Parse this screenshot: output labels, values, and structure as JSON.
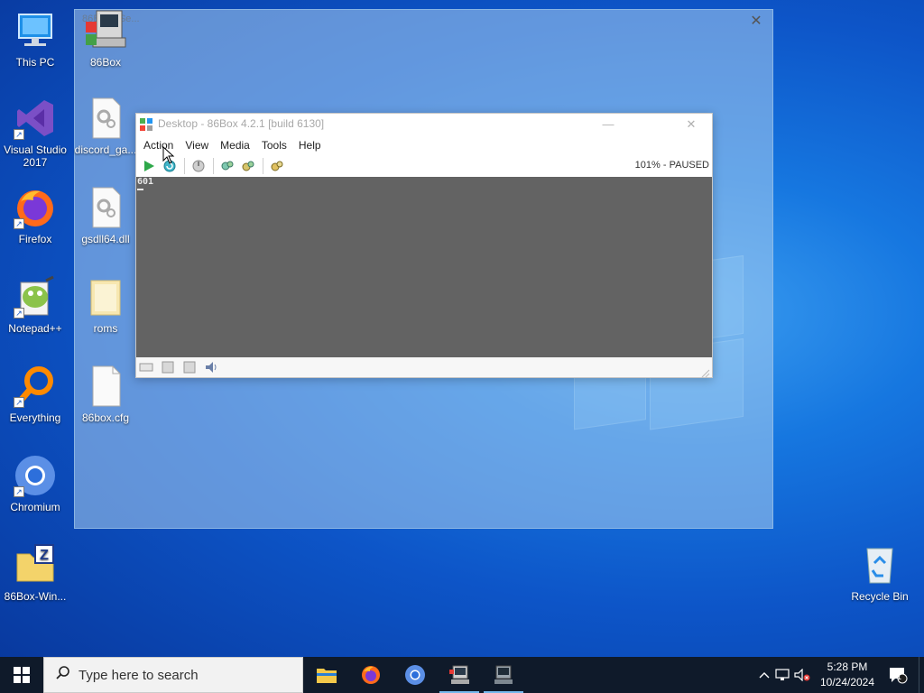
{
  "desktop": {
    "icons_col1": [
      {
        "label": "This PC",
        "icon": "this-pc-icon"
      },
      {
        "label": "Visual Studio 2017",
        "icon": "visual-studio-icon"
      },
      {
        "label": "Firefox",
        "icon": "firefox-icon"
      },
      {
        "label": "Notepad++",
        "icon": "notepad-plus-plus-icon"
      },
      {
        "label": "Everything",
        "icon": "everything-search-icon"
      },
      {
        "label": "Chromium",
        "icon": "chromium-icon"
      },
      {
        "label": "86Box-Win...",
        "icon": "zip-archive-icon"
      }
    ],
    "icons_col2": [
      {
        "label": "86Box",
        "icon": "86box-app-icon"
      },
      {
        "label": "discord_ga...",
        "icon": "dll-file-icon"
      },
      {
        "label": "gsdll64.dll",
        "icon": "dll-file-icon"
      },
      {
        "label": "roms",
        "icon": "folder-icon"
      },
      {
        "label": "86box.cfg",
        "icon": "cfg-file-icon"
      }
    ],
    "recycle_bin": {
      "label": "Recycle Bin",
      "icon": "recycle-bin-icon"
    }
  },
  "glass_window": {
    "title": "86Box - Se...",
    "close_glyph": "✕"
  },
  "box_window": {
    "title": "Desktop - 86Box 4.2.1 [build 6130]",
    "minimize_glyph": "—",
    "close_glyph": "✕",
    "menu": [
      "Action",
      "View",
      "Media",
      "Tools",
      "Help"
    ],
    "toolbar": {
      "buttons": [
        "play-icon",
        "reset-icon",
        "power-icon",
        "settings-icon",
        "cpu-icon",
        "media-icon"
      ],
      "status": "101% - PAUSED"
    },
    "screen": {
      "text": "601",
      "bg_color": "#636363"
    },
    "statusbar": [
      "keyboard-icon",
      "floppy-icon",
      "hdd-icon",
      "sound-icon"
    ]
  },
  "taskbar": {
    "search_placeholder": "Type here to search",
    "apps": [
      "file-explorer-icon",
      "firefox-icon",
      "chromium-icon",
      "86box-taskbar-icon",
      "86box-vm-taskbar-icon"
    ],
    "clock_time": "5:28 PM",
    "clock_date": "10/24/2024",
    "notification_count": "1"
  },
  "colors": {
    "taskbar_bg": "#0f1a2a",
    "accent": "#76b9ed"
  }
}
